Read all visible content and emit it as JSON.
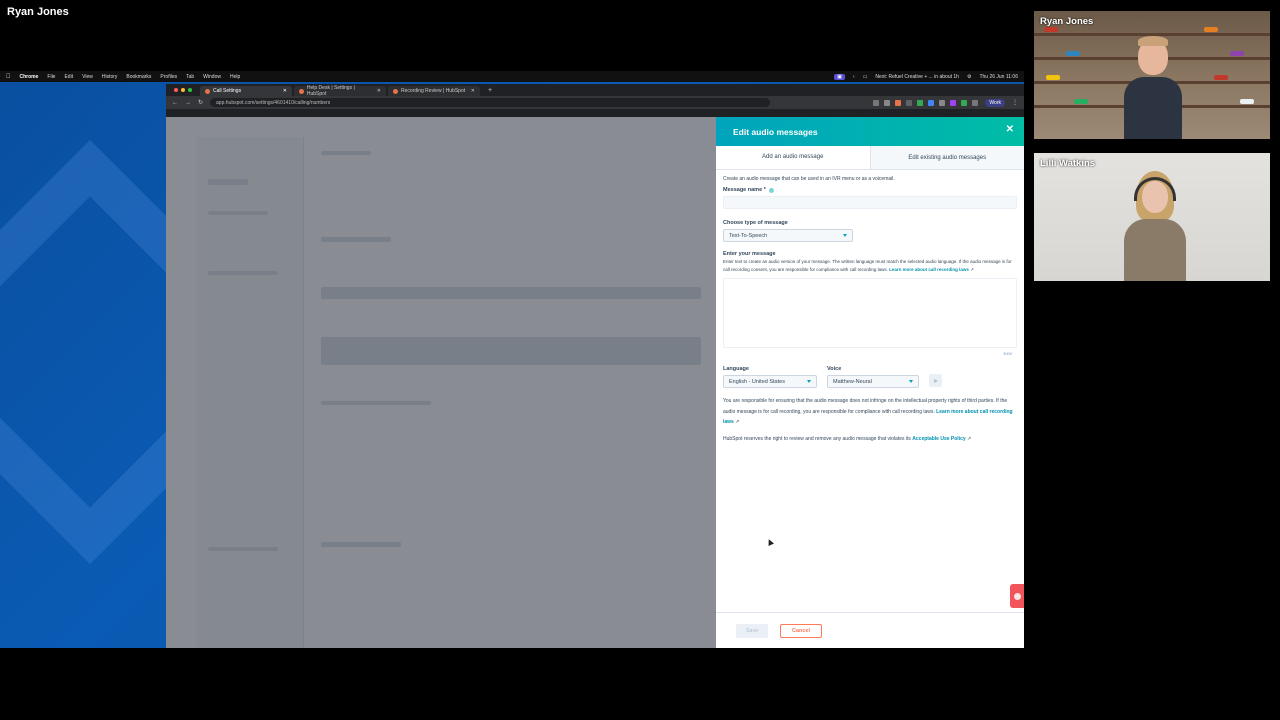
{
  "presenter": "Ryan Jones",
  "mac_menu": {
    "app": "Chrome",
    "items": [
      "File",
      "Edit",
      "View",
      "History",
      "Bookmarks",
      "Profiles",
      "Tab",
      "Window",
      "Help"
    ],
    "status_meeting": "Next: Refuel Creative + ... in about 1h",
    "date_time": "Thu 26 Jun  11:06"
  },
  "browser": {
    "tabs": [
      {
        "label": "Call Settings"
      },
      {
        "label": "Help Desk | Settings | HubSpot"
      },
      {
        "label": "Recording Review | HubSpot"
      }
    ],
    "url": "app.hubspot.com/settings/4601410/calling/numbers",
    "profile": "Work"
  },
  "panel": {
    "title": "Edit audio messages",
    "tabs": {
      "add": "Add an audio message",
      "edit": "Edit existing audio messages"
    },
    "intro": "Create an audio message that can be used in an IVR menu or as a voicemail.",
    "message_name_label": "Message name *",
    "type_label": "Choose type of message",
    "type_value": "Text-To-Speech",
    "enter_label": "Enter your message",
    "enter_help": "Enter text to create an audio version of your message. The written language must match the selected audio language. If the audio message is for call recording consent, you are responsible for compliance with call recording laws.",
    "enter_link": "Learn more about call recording laws",
    "char_count": "3000",
    "language_label": "Language",
    "language_value": "English - United States",
    "voice_label": "Voice",
    "voice_value": "Matthew-Neural",
    "legal1": "You are responsible for ensuring that the audio message does not infringe on the intellectual property rights of third parties. If the audio message is for call recording, you are responsible for compliance with call recording laws.",
    "legal1_link": "Learn more about call recording laws",
    "legal2": "HubSpot reserves the right to review and remove any audio message that violates its",
    "legal2_link": "Acceptable Use Policy",
    "save": "Save",
    "cancel": "Cancel"
  },
  "participants": [
    {
      "name": "Ryan Jones"
    },
    {
      "name": "Lilli Watkins"
    }
  ],
  "colors": {
    "header_start": "#00a4bd",
    "header_end": "#00bda5",
    "cancel": "#ff7a59",
    "link": "#0091ae"
  }
}
